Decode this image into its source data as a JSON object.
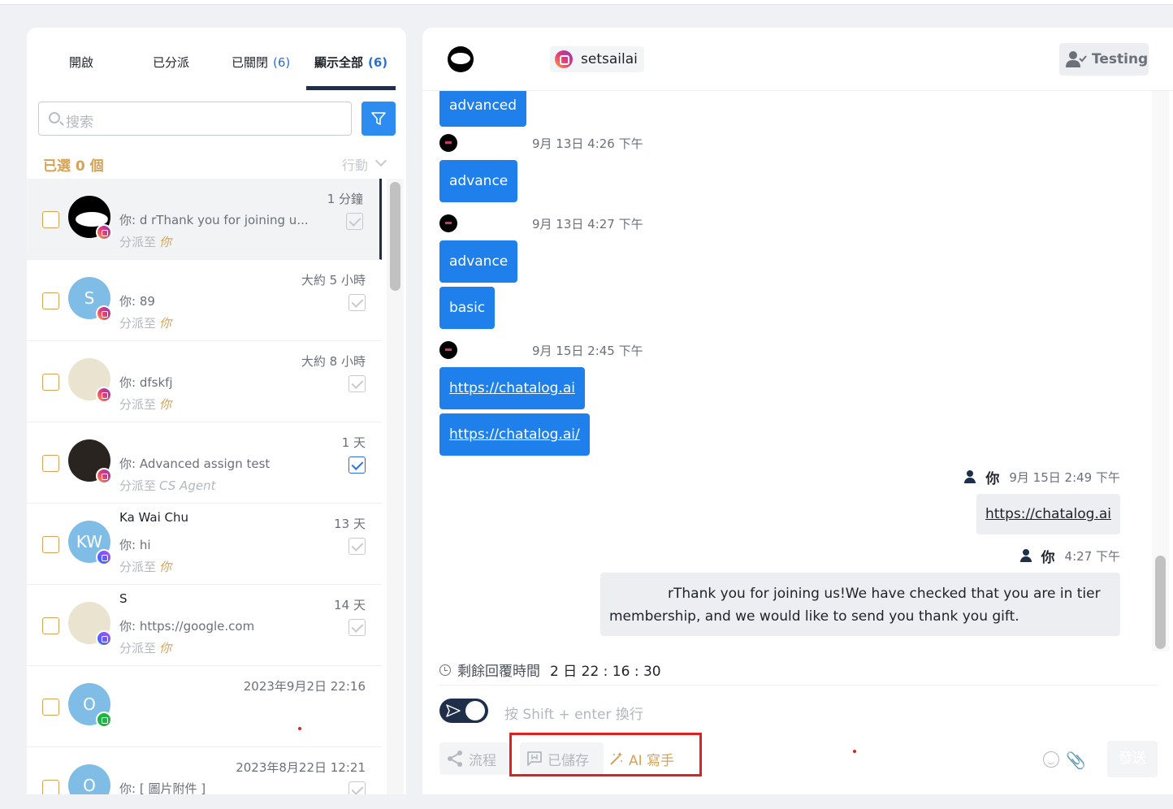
{
  "tabs": [
    {
      "label": "開啟",
      "count": ""
    },
    {
      "label": "已分派",
      "count": ""
    },
    {
      "label": "已關閉",
      "count": "(6)"
    },
    {
      "label": "顯示全部",
      "count": "(6)"
    }
  ],
  "search": {
    "placeholder": "搜索"
  },
  "selection": {
    "selected_label": "已選 0 個",
    "action_label": "行動"
  },
  "conversations": [
    {
      "name": "",
      "time": "1 分鐘",
      "message": "你: d           rThank you for joining u...",
      "assign_prefix": "分派至",
      "assignee": "你",
      "avatar_text": "",
      "channel": "instagram",
      "done": false
    },
    {
      "name": "",
      "time": "大約 5 小時",
      "message": "你: 89",
      "assign_prefix": "分派至",
      "assignee": "你",
      "avatar_text": "S",
      "channel": "instagram",
      "done": false
    },
    {
      "name": "",
      "time": "大約 8 小時",
      "message": "你: dfskfj",
      "assign_prefix": "分派至",
      "assignee": "你",
      "avatar_text": "",
      "channel": "instagram",
      "done": false
    },
    {
      "name": "",
      "time": "1 天",
      "message": "你: Advanced assign test",
      "assign_prefix": "分派至",
      "assignee": "CS Agent",
      "avatar_text": "",
      "channel": "instagram",
      "done": true
    },
    {
      "name": "Ka Wai Chu",
      "time": "13 天",
      "message": "你: hi",
      "assign_prefix": "分派至",
      "assignee": "你",
      "avatar_text": "KW",
      "channel": "messenger",
      "done": false
    },
    {
      "name": "S",
      "time": "14 天",
      "message": "你: https://google.com",
      "assign_prefix": "分派至",
      "assignee": "你",
      "avatar_text": "",
      "channel": "messenger",
      "done": false
    },
    {
      "name": "",
      "time": "2023年9月2日 22:16",
      "message": "",
      "assign_prefix": "",
      "assignee": "",
      "avatar_text": "O",
      "channel": "wechat",
      "done": false
    },
    {
      "name": "",
      "time": "2023年8月22日 12:21",
      "message": "你: [ 圖片附件 ]",
      "assign_prefix": "",
      "assignee": "",
      "avatar_text": "O",
      "channel": "",
      "done": false
    }
  ],
  "chat_header": {
    "contact_name": "",
    "channel_handle": "setsailai",
    "agent_button": "Testing"
  },
  "messages": {
    "m1": "advanced",
    "s2_time": "9月 13日 4:26 下午",
    "m2": "advance",
    "s3_time": "9月 13日 4:27 下午",
    "m3": "advance",
    "m4": "basic",
    "s4_time": "9月 15日 2:45 下午",
    "m5": "https://chatalog.ai",
    "m6": "https://chatalog.ai/",
    "me_label": "你",
    "o1_time": "9月 15日 2:49 下午",
    "o1": "https://chatalog.ai",
    "o2_time": "4:27 下午",
    "o2_line1": "rThank you for joining us!We have checked that you are in  tier",
    "o2_line2": "membership, and we would like to send you thank you gift."
  },
  "reply_timer": {
    "label": "剩餘回覆時間",
    "value": "2 日 22 : 16 : 30"
  },
  "composer": {
    "placeholder": "按 Shift + enter 換行"
  },
  "toolbar": {
    "flow": "流程",
    "saved": "已儲存",
    "ai_writer": "AI 寫手",
    "send": "發送"
  },
  "colors": {
    "accent": "#1f80ec",
    "brand_dark": "#1f2f4a",
    "gold": "#d6a356",
    "highlight": "#e02020"
  }
}
